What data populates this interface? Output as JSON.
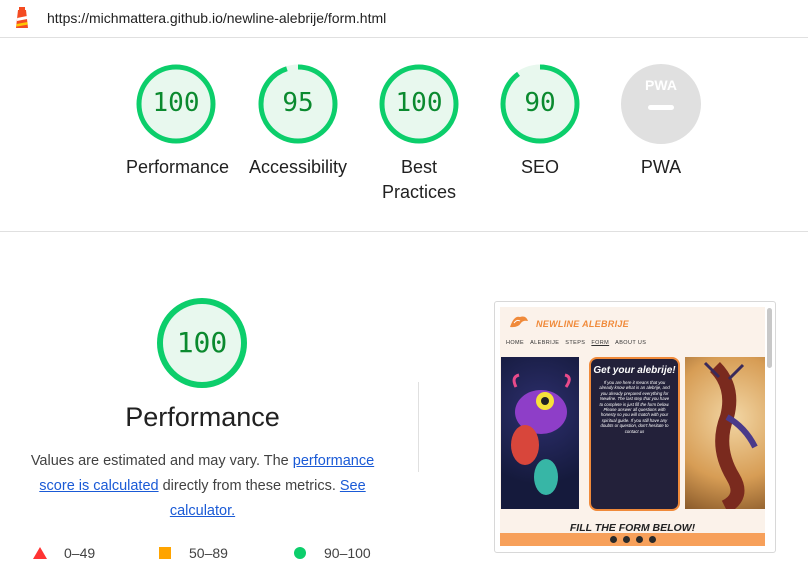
{
  "browser": {
    "url": "https://michmattera.github.io/newline-alebrije/form.html"
  },
  "scores": [
    {
      "name": "performance",
      "value": "100",
      "label": "Performance",
      "fraction": 1.0
    },
    {
      "name": "accessibility",
      "value": "95",
      "label": "Accessibility",
      "fraction": 0.95
    },
    {
      "name": "best-practices",
      "value": "100",
      "label": "Best Practices",
      "fraction": 1.0
    },
    {
      "name": "seo",
      "value": "90",
      "label": "SEO",
      "fraction": 0.9
    },
    {
      "name": "pwa",
      "value": "PWA",
      "label": "PWA"
    }
  ],
  "main": {
    "score": "100",
    "title": "Performance",
    "desc_1": "Values are estimated and may vary. The ",
    "desc_link_1": "performance score is calculated",
    "desc_2": " directly from these metrics. ",
    "desc_link_2": "See calculator."
  },
  "legend": {
    "fail": "0–49",
    "average": "50–89",
    "pass": "90–100"
  },
  "screenshot": {
    "brand": "NEWLINE ALEBRIJE",
    "nav": [
      "HOME",
      "ALEBRIJE",
      "STEPS",
      "FORM",
      "ABOUT US"
    ],
    "card_title": "Get your alebrije!",
    "card_body": "If you are here it means that you already know what is an alebrije, and you already prepared everything for Newline. The last step that you have to complete is just fill the form below. Please answer all questions with honesty so you will match with your spiritual guide. If you still have any doubts or question, don't hesitate to contact us",
    "fill": "FILL THE FORM BELOW!"
  },
  "colors": {
    "pass": "#0cce6b",
    "pass_bg": "#e8f8ee",
    "pass_text": "#0b8a2f",
    "fail": "#ff3333",
    "average": "#ffa400",
    "pwa_bg": "#e0e0e0"
  }
}
